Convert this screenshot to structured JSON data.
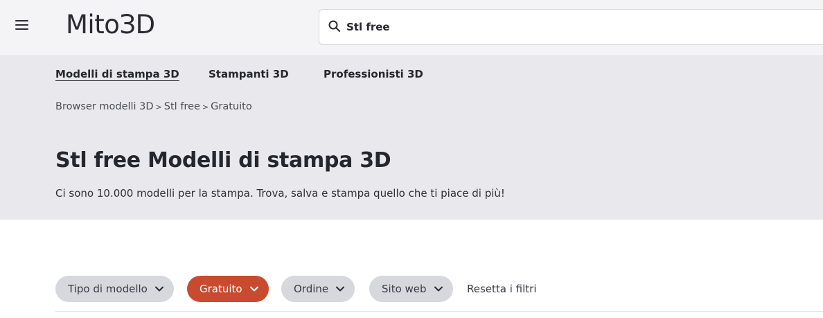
{
  "header": {
    "logo_text": "MitoЗD",
    "search": {
      "value": "Stl free",
      "placeholder": ""
    }
  },
  "nav": {
    "items": [
      {
        "label": "Modelli di stampa 3D",
        "active": true
      },
      {
        "label": "Stampanti 3D",
        "active": false
      },
      {
        "label": "Professionisti 3D",
        "active": false
      }
    ]
  },
  "breadcrumb": {
    "items": [
      "Browser modelli 3D",
      "Stl free",
      "Gratuito"
    ],
    "separator": ">"
  },
  "page": {
    "title": "Stl free Modelli di stampa 3D",
    "subtitle": "Ci sono 10.000 modelli per la stampa. Trova, salva e stampa quello che ti piace di più!"
  },
  "filters": {
    "chips": [
      {
        "label": "Tipo di modello",
        "active": false
      },
      {
        "label": "Gratuito",
        "active": true
      },
      {
        "label": "Ordine",
        "active": false
      },
      {
        "label": "Sito web",
        "active": false
      }
    ],
    "reset_label": "Resetta i filtri"
  },
  "colors": {
    "accent": "#c84b30",
    "hero_bg": "#e9e9ed",
    "topbar_bg": "#f4f4f6",
    "chip_bg": "#d7d7de"
  },
  "icons": {
    "menu": "hamburger-menu-icon",
    "search": "search-icon",
    "chevron": "chevron-down-icon"
  }
}
